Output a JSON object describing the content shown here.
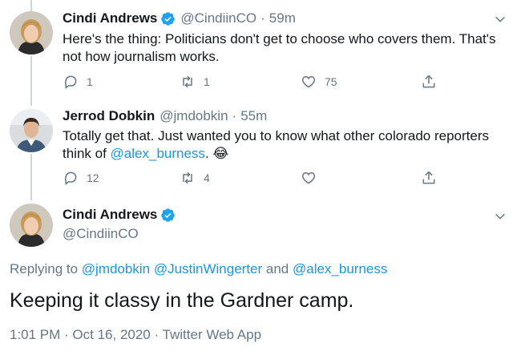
{
  "tweets": [
    {
      "display_name": "Cindi Andrews",
      "handle": "@CindiinCO",
      "separator": "·",
      "time": "59m",
      "text": "Here's the thing: Politicians don't get to choose who covers them. That's not how journalism works.",
      "replies": "1",
      "retweets": "1",
      "likes": "75"
    },
    {
      "display_name": "Jerrod Dobkin",
      "handle": "@jmdobkin",
      "separator": "·",
      "time": "55m",
      "text_before": "Totally get that. Just wanted you to know what other colorado reporters think of ",
      "mention": "@alex_burness",
      "text_after": ". ",
      "emoji": "😂",
      "replies": "12",
      "retweets": "4",
      "likes": ""
    }
  ],
  "main_tweet": {
    "display_name": "Cindi Andrews",
    "handle": "@CindiinCO",
    "replying_prefix": "Replying to ",
    "replying_to": [
      "@jmdobkin",
      "@JustinWingerter",
      "@alex_burness"
    ],
    "replying_and": " and ",
    "text": "Keeping it classy in the Gardner camp.",
    "timestamp": "1:01 PM · Oct 16, 2020 · Twitter Web App"
  },
  "colors": {
    "accent": "#1b95e0",
    "verified": "#1da1f2",
    "secondary_text": "#657786"
  },
  "icons": [
    "reply-icon",
    "retweet-icon",
    "like-icon",
    "share-icon",
    "chevron-down-icon",
    "verified-badge-icon"
  ]
}
